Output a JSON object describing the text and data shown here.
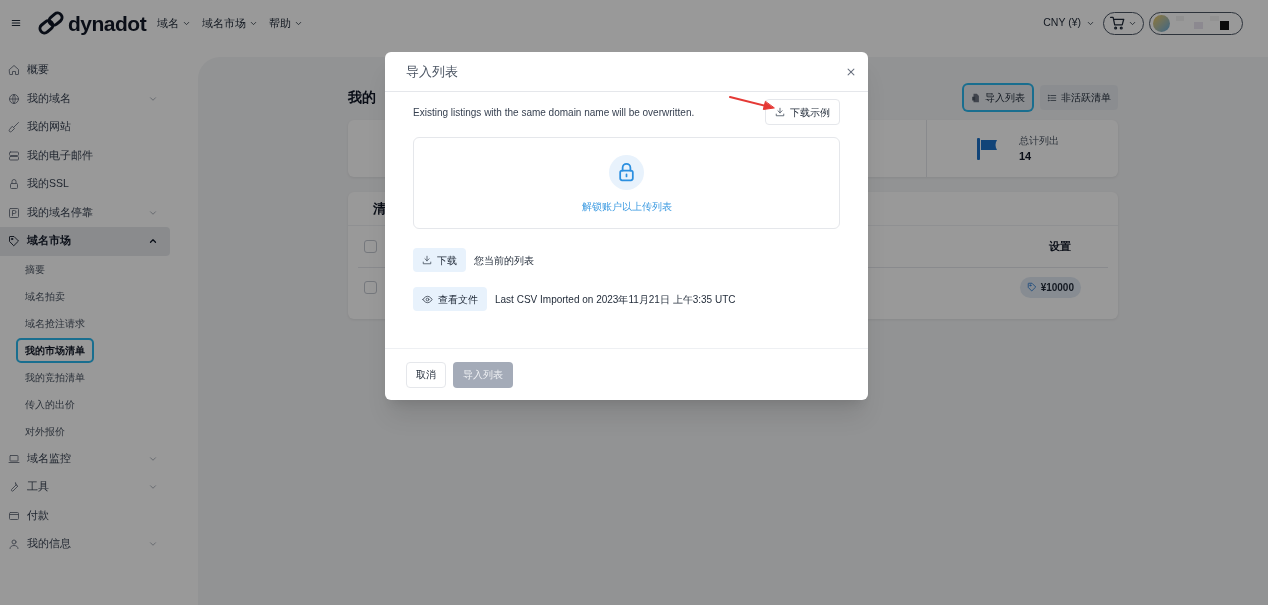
{
  "header": {
    "logo": "dynadot",
    "nav": [
      {
        "label": "域名"
      },
      {
        "label": "域名市场"
      },
      {
        "label": "帮助"
      }
    ],
    "currency": "CNY (¥)"
  },
  "sidebar": {
    "items": [
      {
        "label": "概要",
        "selected": false
      },
      {
        "label": "我的域名",
        "selected": false,
        "expanded": false
      },
      {
        "label": "我的网站",
        "selected": false
      },
      {
        "label": "我的电子邮件",
        "selected": false
      },
      {
        "label": "我的SSL",
        "selected": false
      },
      {
        "label": "我的域名停靠",
        "selected": false,
        "expanded": false
      },
      {
        "label": "域名市场",
        "selected": true,
        "expanded": true,
        "children": [
          {
            "label": "摘要",
            "selected": false
          },
          {
            "label": "域名拍卖",
            "selected": false
          },
          {
            "label": "域名抢注请求",
            "selected": false
          },
          {
            "label": "我的市场清单",
            "selected": true
          },
          {
            "label": "我的竞拍清单",
            "selected": false
          },
          {
            "label": "传入的出价",
            "selected": false
          },
          {
            "label": "对外报价",
            "selected": false
          }
        ]
      },
      {
        "label": "域名监控",
        "selected": false,
        "expanded": false
      },
      {
        "label": "工具",
        "selected": false,
        "expanded": false
      },
      {
        "label": "付款",
        "selected": false
      },
      {
        "label": "我的信息",
        "selected": false,
        "expanded": false
      }
    ]
  },
  "page": {
    "title": "我的",
    "actions": [
      {
        "label": "导入列表",
        "focused": true
      },
      {
        "label": "非活跃清单",
        "focused": false
      }
    ],
    "stats": [
      {
        "label": "总计列出",
        "value": "14"
      }
    ],
    "table": {
      "title": "清",
      "select_all": {
        "checked": false
      },
      "columns": [
        {
          "label": "设置"
        }
      ],
      "rows": [
        {
          "checked": false,
          "price": "¥10000"
        }
      ]
    }
  },
  "modal": {
    "title": "导入列表",
    "notice": "Existing listings with the same domain name will be overwritten.",
    "sample_button": "下载示例",
    "upload": {
      "message": "解锁账户以上传列表"
    },
    "rows": [
      {
        "kind": "download",
        "button": "下载",
        "text": "您当前的列表"
      },
      {
        "kind": "view",
        "button": "查看文件",
        "text": "Last CSV Imported on 2023年11月21日 上午3:35 UTC"
      }
    ],
    "footer": [
      {
        "kind": "secondary",
        "label": "取消",
        "disabled": false
      },
      {
        "kind": "primary",
        "label": "导入列表",
        "disabled": true
      }
    ]
  }
}
